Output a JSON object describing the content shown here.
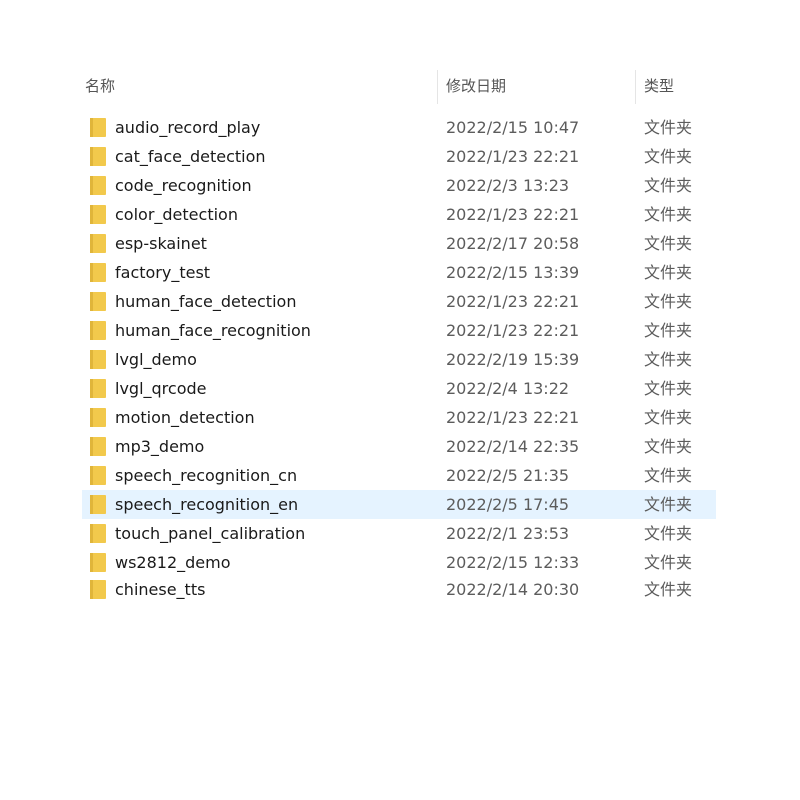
{
  "columns": {
    "name": "名称",
    "modified": "修改日期",
    "type": "类型"
  },
  "icons": {
    "folder": "folder-icon",
    "folder_color": "#f2c94c"
  },
  "colors": {
    "selection": "#e5f3ff"
  },
  "selected_item": "speech_recognition_en",
  "files": [
    {
      "name": "audio_record_play",
      "modified": "2022/2/15 10:47",
      "type": "文件夹"
    },
    {
      "name": "cat_face_detection",
      "modified": "2022/1/23 22:21",
      "type": "文件夹"
    },
    {
      "name": "code_recognition",
      "modified": "2022/2/3 13:23",
      "type": "文件夹"
    },
    {
      "name": "color_detection",
      "modified": "2022/1/23 22:21",
      "type": "文件夹"
    },
    {
      "name": "esp-skainet",
      "modified": "2022/2/17 20:58",
      "type": "文件夹"
    },
    {
      "name": "factory_test",
      "modified": "2022/2/15 13:39",
      "type": "文件夹"
    },
    {
      "name": "human_face_detection",
      "modified": "2022/1/23 22:21",
      "type": "文件夹"
    },
    {
      "name": "human_face_recognition",
      "modified": "2022/1/23 22:21",
      "type": "文件夹"
    },
    {
      "name": "lvgl_demo",
      "modified": "2022/2/19 15:39",
      "type": "文件夹"
    },
    {
      "name": "lvgl_qrcode",
      "modified": "2022/2/4 13:22",
      "type": "文件夹"
    },
    {
      "name": "motion_detection",
      "modified": "2022/1/23 22:21",
      "type": "文件夹"
    },
    {
      "name": "mp3_demo",
      "modified": "2022/2/14 22:35",
      "type": "文件夹"
    },
    {
      "name": "speech_recognition_cn",
      "modified": "2022/2/5 21:35",
      "type": "文件夹"
    },
    {
      "name": "speech_recognition_en",
      "modified": "2022/2/5 17:45",
      "type": "文件夹"
    },
    {
      "name": "touch_panel_calibration",
      "modified": "2022/2/1 23:53",
      "type": "文件夹"
    },
    {
      "name": "ws2812_demo",
      "modified": "2022/2/15 12:33",
      "type": "文件夹"
    },
    {
      "name": "chinese_tts",
      "modified": "2022/2/14 20:30",
      "type": "文件夹"
    }
  ]
}
